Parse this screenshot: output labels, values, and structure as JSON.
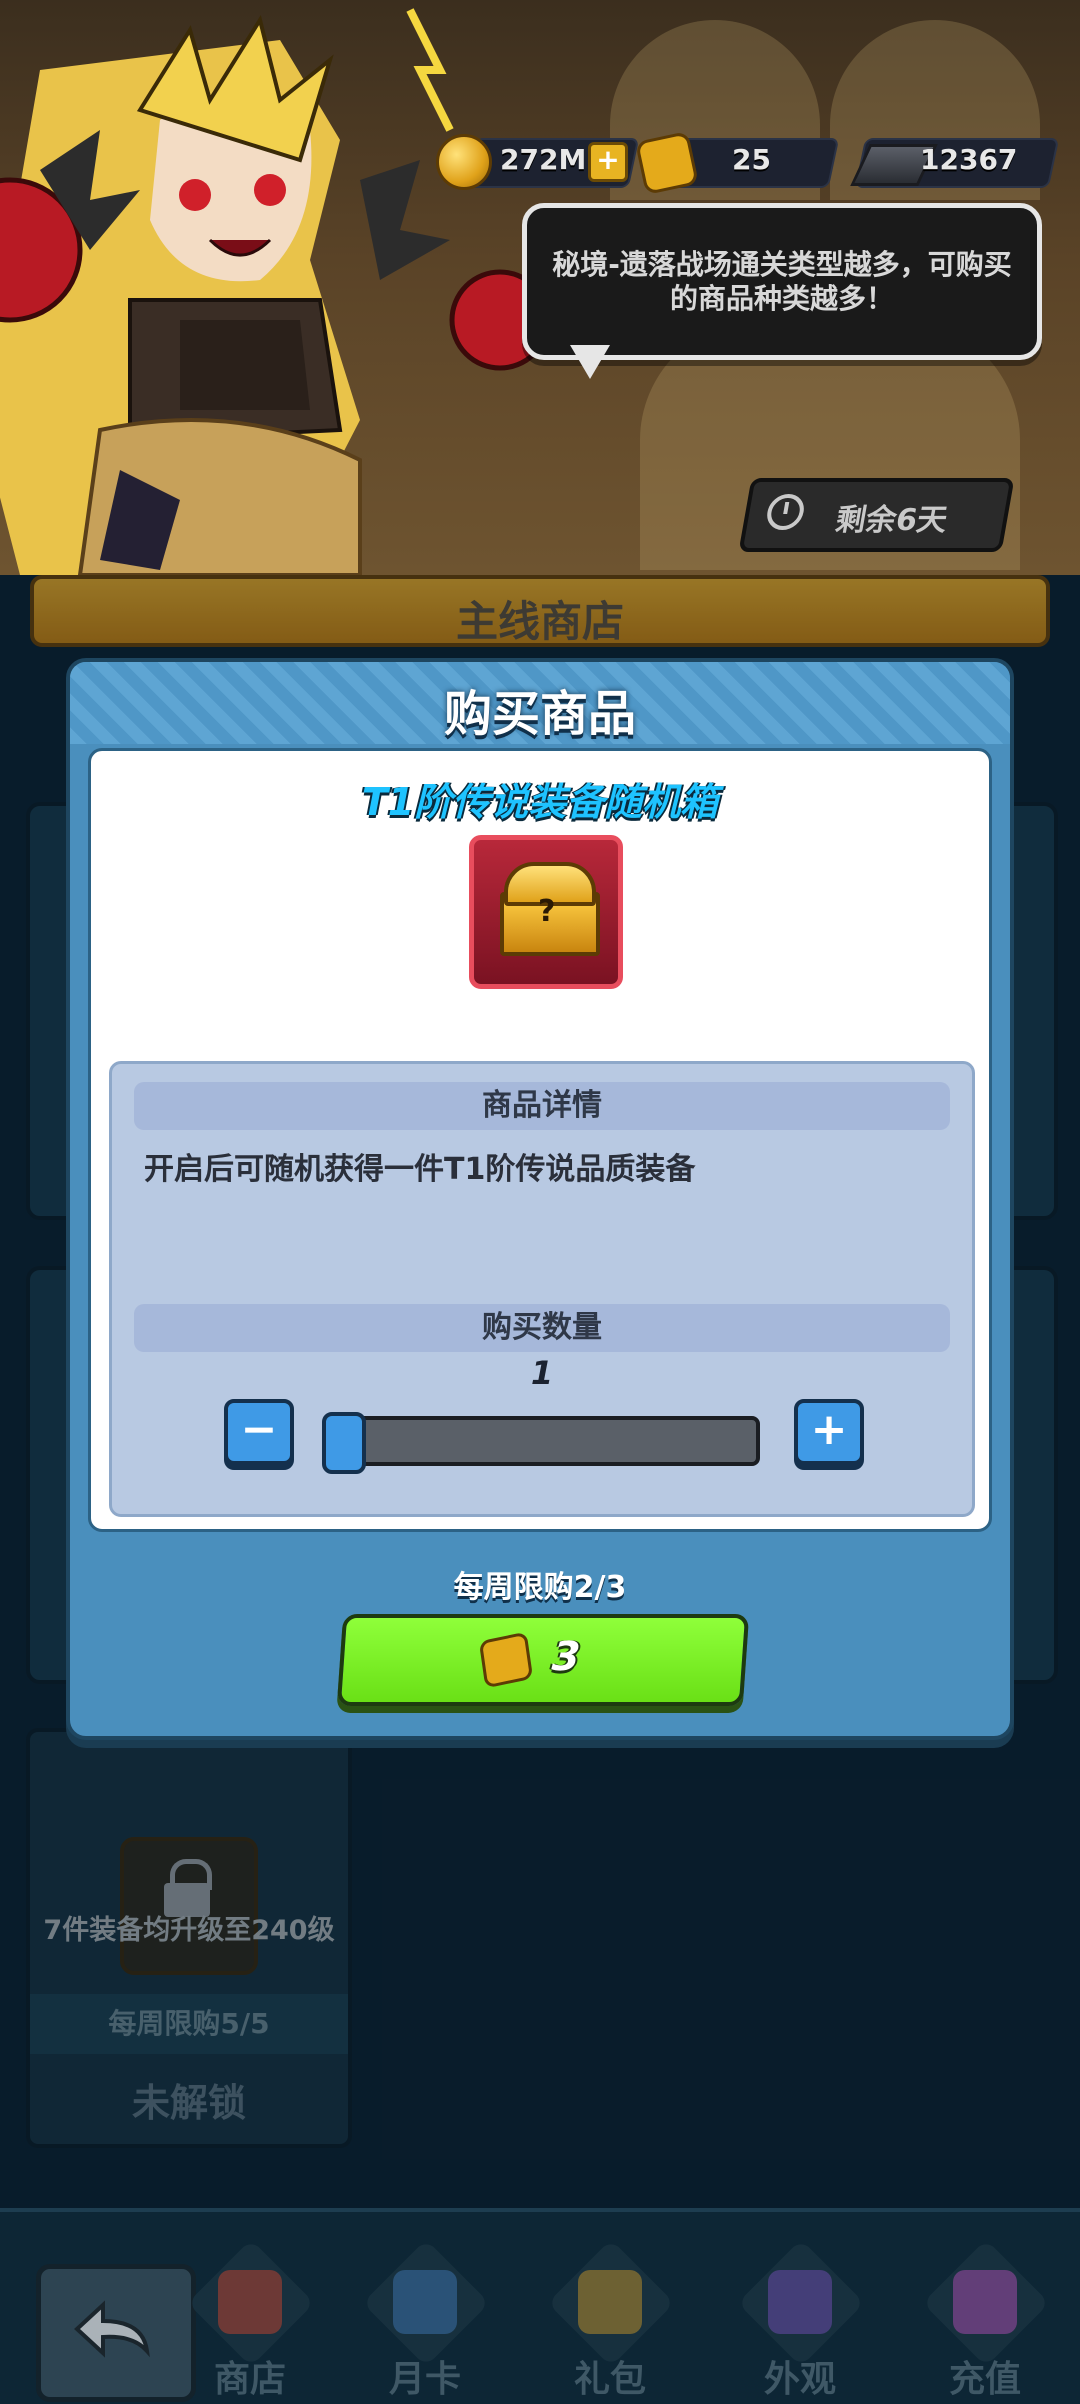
{
  "currency": {
    "gold": "272M",
    "tickets": "25",
    "iron": "12367"
  },
  "banner": {
    "tip": "秘境-遗落战场通关类型越多，可购买的商品种类越多！",
    "timer": "剩余6天"
  },
  "shop": {
    "title": "主线商店"
  },
  "locked_item": {
    "condition": "7件装备均升级至240级",
    "weekly": "每周限购5/5",
    "status": "未解锁"
  },
  "modal": {
    "title": "购买商品",
    "item_name": "T1阶传说装备随机箱",
    "details_header": "商品详情",
    "description": "开启后可随机获得一件T1阶传说品质装备",
    "quantity_header": "购买数量",
    "quantity": "1",
    "quantity_level": 0.0,
    "minus_label": "−",
    "plus_label": "+",
    "weekly_limit": "每周限购2/3",
    "price": "3"
  },
  "nav": {
    "items": [
      {
        "label": "商店",
        "icon": "shop-icon"
      },
      {
        "label": "月卡",
        "icon": "monthly-card-icon"
      },
      {
        "label": "礼包",
        "icon": "gift-pack-icon"
      },
      {
        "label": "外观",
        "icon": "wizard-hat-icon"
      },
      {
        "label": "充值",
        "icon": "gem-icon"
      }
    ]
  }
}
